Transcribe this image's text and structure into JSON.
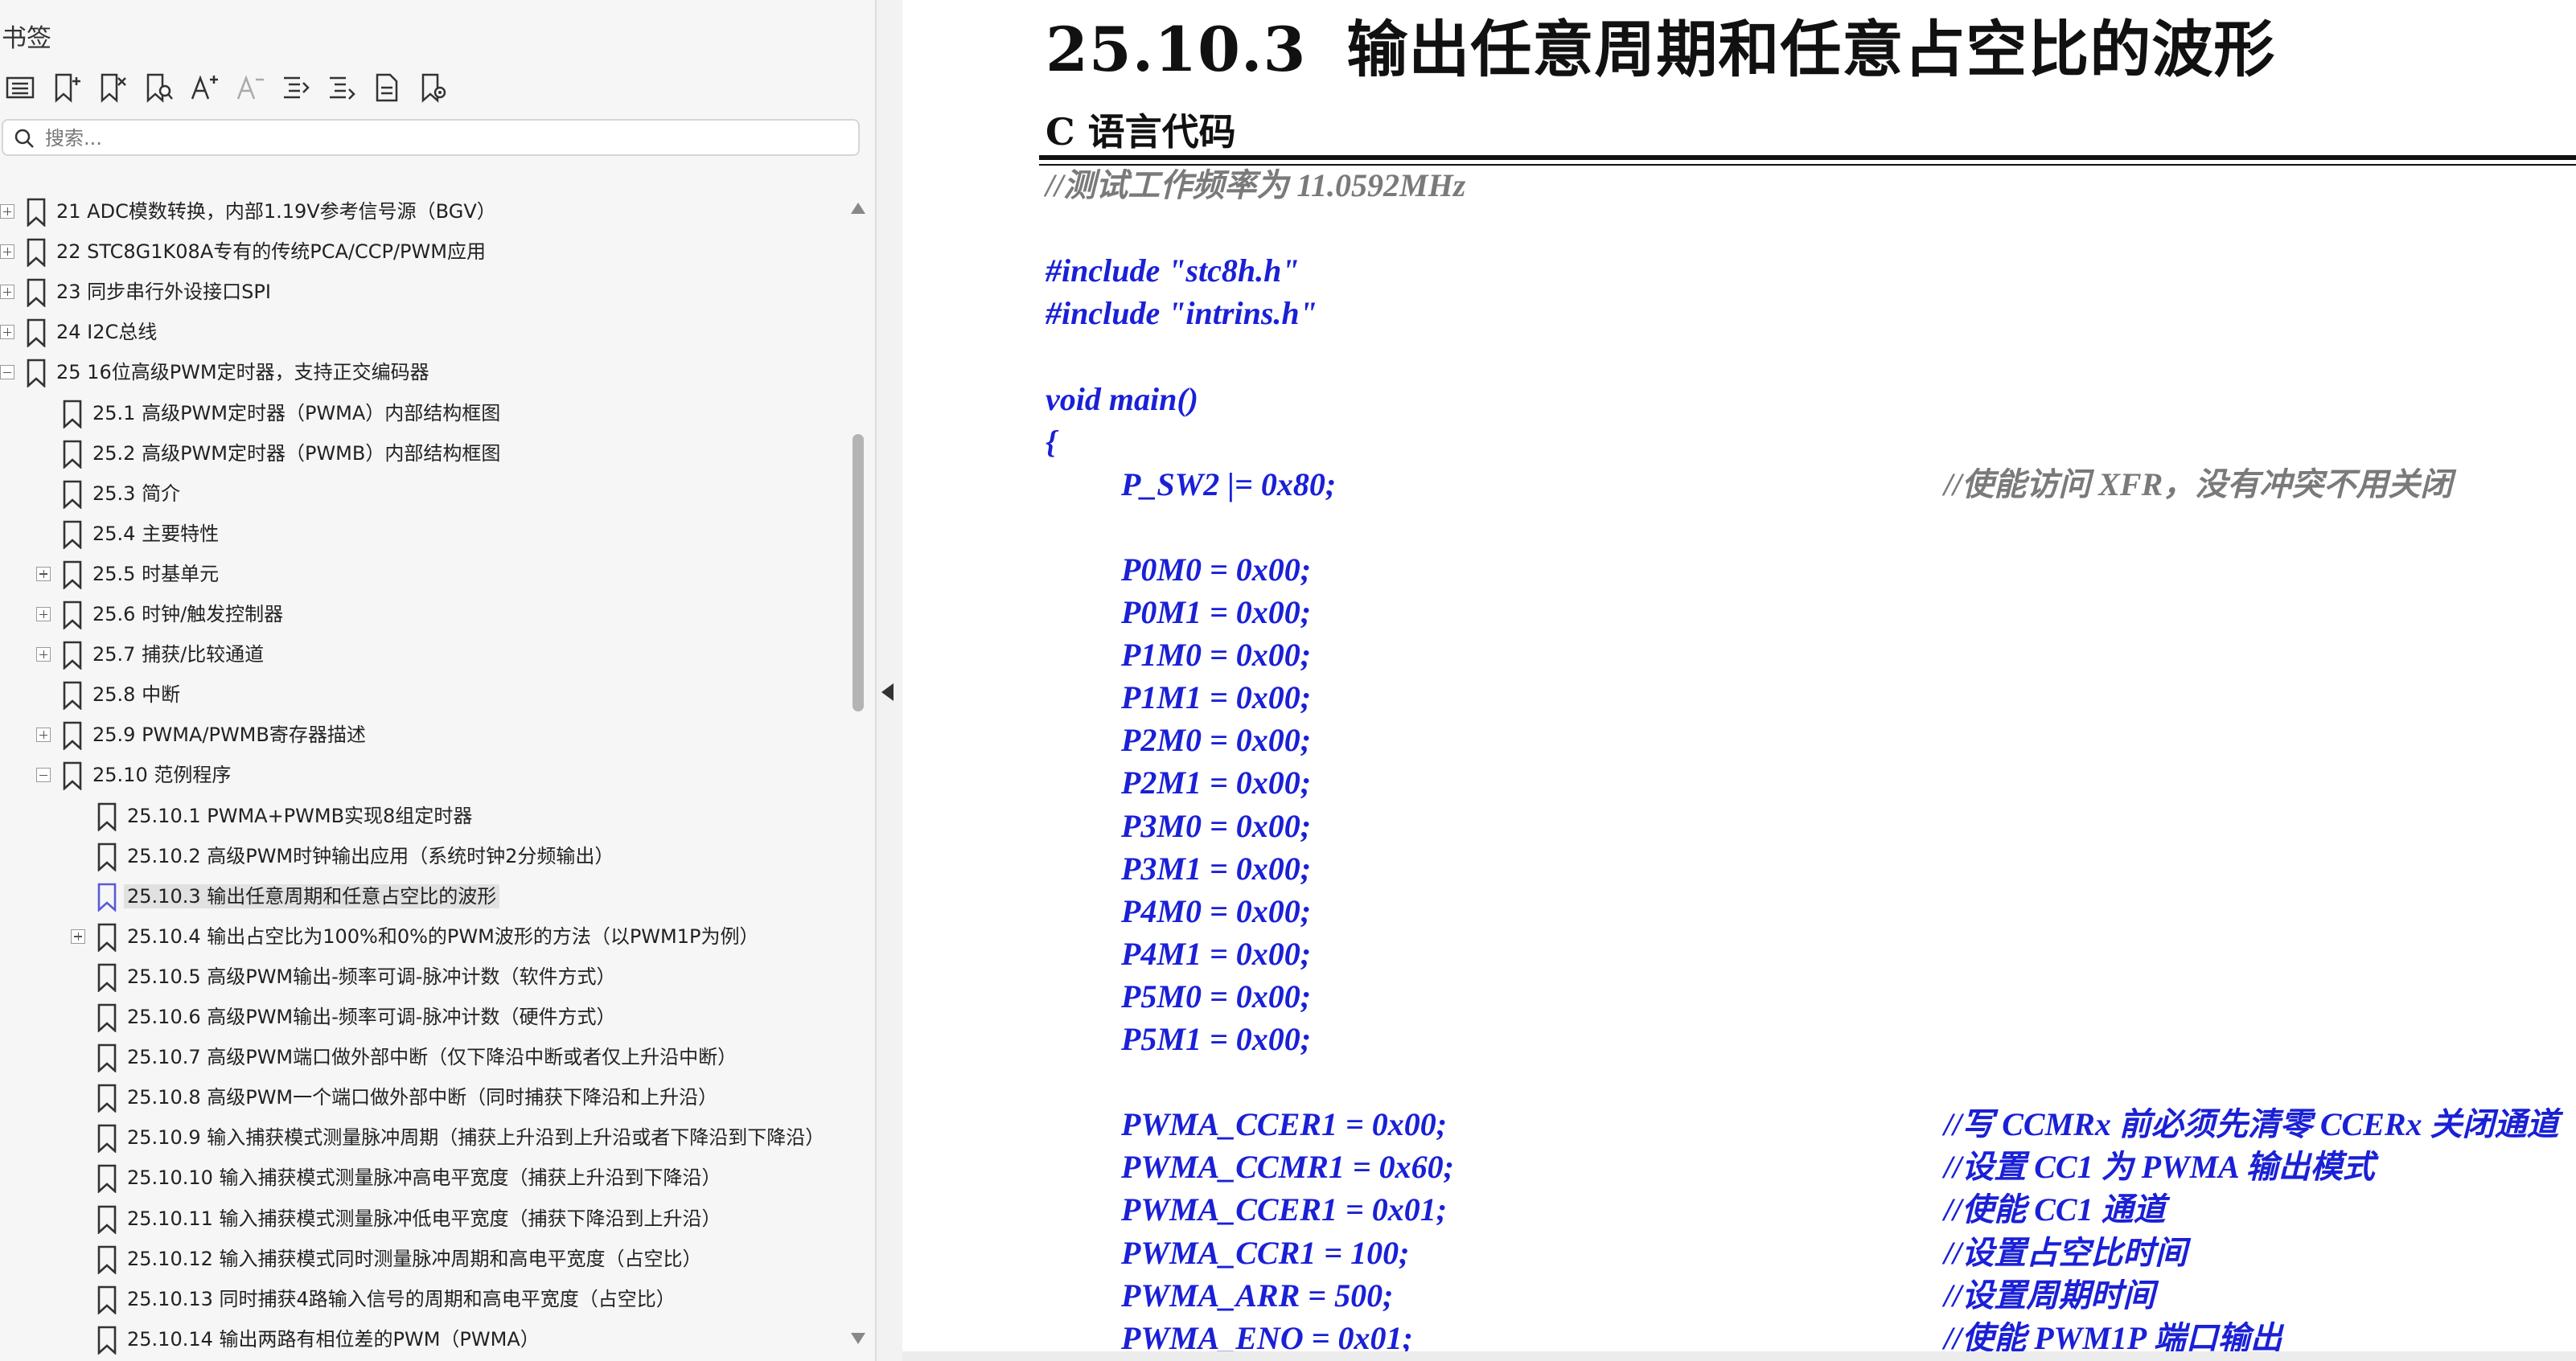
{
  "bookmarks_panel": {
    "title": "书签",
    "toolbar": [
      {
        "icon": "list-icon"
      },
      {
        "icon": "add-bookmark-icon"
      },
      {
        "icon": "delete-bookmark-icon"
      },
      {
        "icon": "find-bookmark-icon"
      },
      {
        "icon": "font-increase-icon"
      },
      {
        "icon": "font-decrease-icon"
      },
      {
        "icon": "expand-all-icon"
      },
      {
        "icon": "collapse-all-icon"
      },
      {
        "icon": "document-icon"
      },
      {
        "icon": "bookmark-settings-icon"
      }
    ],
    "search_placeholder": "搜索...",
    "items": [
      {
        "label": "21  ADC模数转换，内部1.19V参考信号源（BGV）",
        "level": 0,
        "expander": "plus"
      },
      {
        "label": "22  STC8G1K08A专有的传统PCA/CCP/PWM应用",
        "level": 0,
        "expander": "plus"
      },
      {
        "label": "23  同步串行外设接口SPI",
        "level": 0,
        "expander": "plus"
      },
      {
        "label": "24  I2C总线",
        "level": 0,
        "expander": "plus"
      },
      {
        "label": "25  16位高级PWM定时器，支持正交编码器",
        "level": 0,
        "expander": "minus"
      },
      {
        "label": "25.1  高级PWM定时器（PWMA）内部结构框图",
        "level": 1,
        "expander": "none"
      },
      {
        "label": "25.2  高级PWM定时器（PWMB）内部结构框图",
        "level": 1,
        "expander": "none"
      },
      {
        "label": "25.3  简介",
        "level": 1,
        "expander": "none"
      },
      {
        "label": "25.4  主要特性",
        "level": 1,
        "expander": "none"
      },
      {
        "label": "25.5  时基单元",
        "level": 1,
        "expander": "plus"
      },
      {
        "label": "25.6 时钟/触发控制器",
        "level": 1,
        "expander": "plus"
      },
      {
        "label": "25.7 捕获/比较通道",
        "level": 1,
        "expander": "plus"
      },
      {
        "label": "25.8 中断",
        "level": 1,
        "expander": "none"
      },
      {
        "label": "25.9  PWMA/PWMB寄存器描述",
        "level": 1,
        "expander": "plus"
      },
      {
        "label": "25.10  范例程序",
        "level": 1,
        "expander": "minus"
      },
      {
        "label": "25.10.1 PWMA+PWMB实现8组定时器",
        "level": 2,
        "expander": "none"
      },
      {
        "label": "25.10.2 高级PWM时钟输出应用（系统时钟2分频输出）",
        "level": 2,
        "expander": "none"
      },
      {
        "label": "25.10.3 输出任意周期和任意占空比的波形",
        "level": 2,
        "expander": "none",
        "selected": true
      },
      {
        "label": "25.10.4 输出占空比为100%和0%的PWM波形的方法（以PWM1P为例）",
        "level": 2,
        "expander": "plus"
      },
      {
        "label": "25.10.5 高级PWM输出-频率可调-脉冲计数（软件方式）",
        "level": 2,
        "expander": "none"
      },
      {
        "label": "25.10.6 高级PWM输出-频率可调-脉冲计数（硬件方式）",
        "level": 2,
        "expander": "none"
      },
      {
        "label": "25.10.7 高级PWM端口做外部中断（仅下降沿中断或者仅上升沿中断）",
        "level": 2,
        "expander": "none"
      },
      {
        "label": "25.10.8  高级PWM一个端口做外部中断（同时捕获下降沿和上升沿）",
        "level": 2,
        "expander": "none"
      },
      {
        "label": "25.10.9  输入捕获模式测量脉冲周期（捕获上升沿到上升沿或者下降沿到下降沿）",
        "level": 2,
        "expander": "none"
      },
      {
        "label": "25.10.10 输入捕获模式测量脉冲高电平宽度（捕获上升沿到下降沿）",
        "level": 2,
        "expander": "none"
      },
      {
        "label": "25.10.11 输入捕获模式测量脉冲低电平宽度（捕获下降沿到上升沿）",
        "level": 2,
        "expander": "none"
      },
      {
        "label": "25.10.12 输入捕获模式同时测量脉冲周期和高电平宽度（占空比）",
        "level": 2,
        "expander": "none"
      },
      {
        "label": "25.10.13 同时捕获4路输入信号的周期和高电平宽度（占空比）",
        "level": 2,
        "expander": "none"
      },
      {
        "label": "25.10.14 输出两路有相位差的PWM（PWMA）",
        "level": 2,
        "expander": "none"
      }
    ]
  },
  "document": {
    "section_number": "25.10.3",
    "section_title": "输出任意周期和任意占空比的波形",
    "subheading": "C 语言代码",
    "code": [
      {
        "code": "",
        "comment": "//测试工作频率为 11.0592MHz",
        "comment_gray": true
      },
      {
        "code": "",
        "comment": ""
      },
      {
        "code": "#include \"stc8h.h\"",
        "comment": ""
      },
      {
        "code": "#include \"intrins.h\"",
        "comment": ""
      },
      {
        "code": "",
        "comment": ""
      },
      {
        "code": "void main()",
        "comment": ""
      },
      {
        "code": "{",
        "comment": ""
      },
      {
        "code": "P_SW2 |= 0x80;",
        "comment": "//使能访问 XFR，没有冲突不用关闭",
        "indent": true,
        "comment_gray": true
      },
      {
        "code": "",
        "comment": ""
      },
      {
        "code": "P0M0 = 0x00;",
        "comment": "",
        "indent": true
      },
      {
        "code": "P0M1 = 0x00;",
        "comment": "",
        "indent": true
      },
      {
        "code": "P1M0 = 0x00;",
        "comment": "",
        "indent": true
      },
      {
        "code": "P1M1 = 0x00;",
        "comment": "",
        "indent": true
      },
      {
        "code": "P2M0 = 0x00;",
        "comment": "",
        "indent": true
      },
      {
        "code": "P2M1 = 0x00;",
        "comment": "",
        "indent": true
      },
      {
        "code": "P3M0 = 0x00;",
        "comment": "",
        "indent": true
      },
      {
        "code": "P3M1 = 0x00;",
        "comment": "",
        "indent": true
      },
      {
        "code": "P4M0 = 0x00;",
        "comment": "",
        "indent": true
      },
      {
        "code": "P4M1 = 0x00;",
        "comment": "",
        "indent": true
      },
      {
        "code": "P5M0 = 0x00;",
        "comment": "",
        "indent": true
      },
      {
        "code": "P5M1 = 0x00;",
        "comment": "",
        "indent": true
      },
      {
        "code": "",
        "comment": ""
      },
      {
        "code": "PWMA_CCER1 = 0x00;",
        "comment": "//写 CCMRx 前必须先清零 CCERx 关闭通道",
        "indent": true
      },
      {
        "code": "PWMA_CCMR1 = 0x60;",
        "comment": "//设置 CC1 为 PWMA 输出模式",
        "indent": true
      },
      {
        "code": "PWMA_CCER1 = 0x01;",
        "comment": "//使能 CC1 通道",
        "indent": true
      },
      {
        "code": "PWMA_CCR1 = 100;",
        "comment": "//设置占空比时间",
        "indent": true
      },
      {
        "code": "PWMA_ARR = 500;",
        "comment": "//设置周期时间",
        "indent": true
      },
      {
        "code": "PWMA_ENO = 0x01;",
        "comment": "//使能 PWM1P 端口输出",
        "indent": true
      }
    ]
  }
}
